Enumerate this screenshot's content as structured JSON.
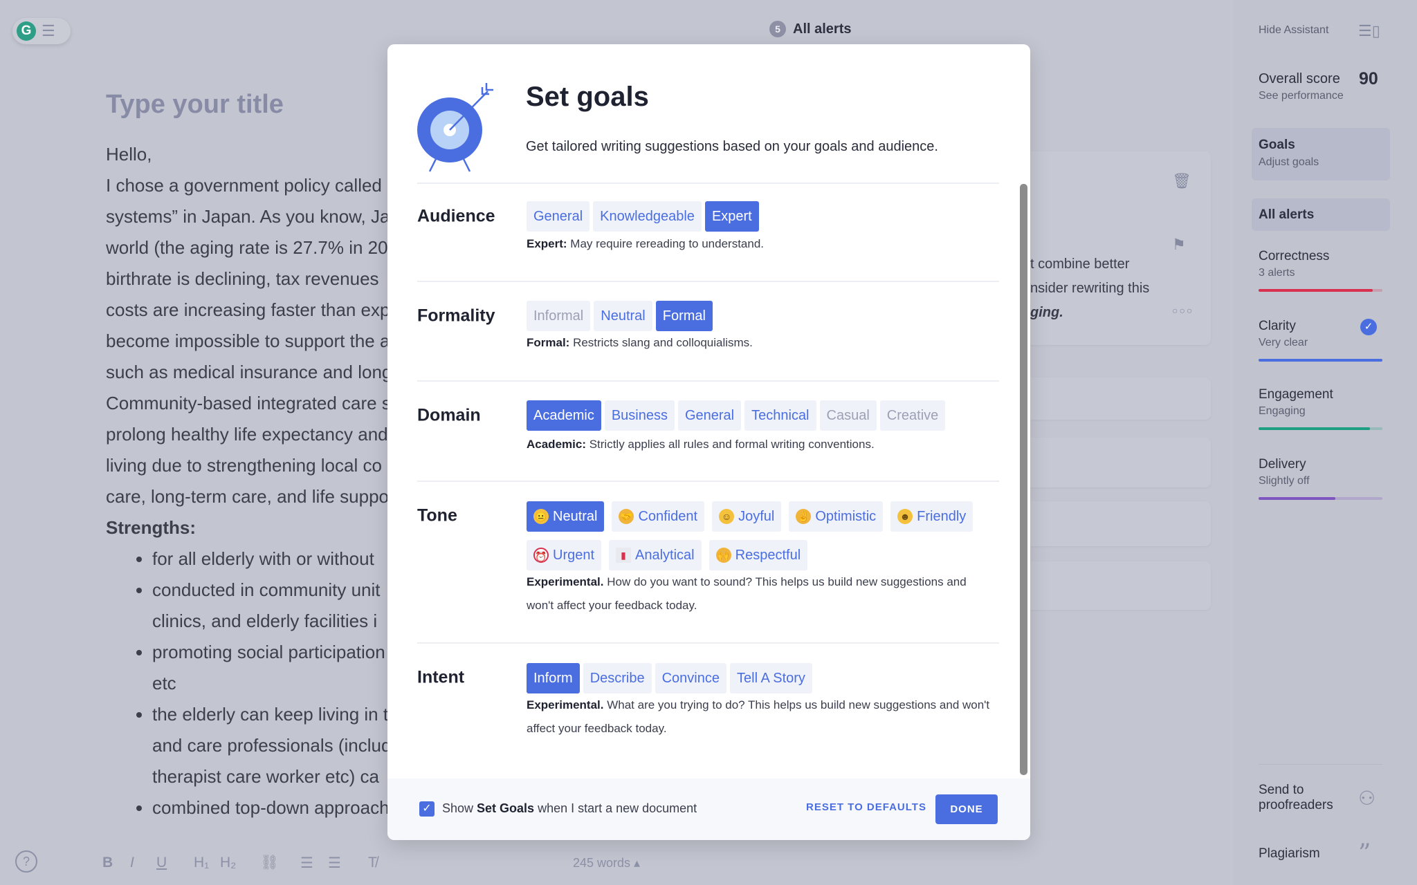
{
  "editor": {
    "title_placeholder": "Type your title",
    "lines": [
      "Hello,",
      "I chose a government policy called “",
      "systems” in Japan. As you know, Ja",
      "world (the aging rate is 27.7% in 20",
      "birthrate is declining, tax revenues",
      "costs are increasing faster than exp",
      "become impossible to support the a",
      "such as medical insurance and long",
      "Community-based integrated care s",
      "prolong healthy life expectancy and",
      "living due to strengthening local co",
      "care, long-term care, and life suppo"
    ],
    "strengths": "Strengths:",
    "bullets": [
      "for all elderly with or without",
      "conducted in community unit",
      "clinics, and elderly facilities i",
      "promoting social participation",
      "etc",
      "the elderly can keep living in t",
      "and care professionals (includ",
      "therapist care worker etc) ca",
      "combined top-down approach"
    ],
    "word_count": "245 words ▴"
  },
  "top": {
    "alert_count": "5",
    "alerts_label": "All alerts"
  },
  "card": {
    "line1": "t combine better",
    "line2": "nsider rewriting this",
    "line3": "ging."
  },
  "sidebar": {
    "hide": "Hide Assistant",
    "overall_label": "Overall score",
    "overall_score": "90",
    "see_performance": "See performance",
    "goals": "Goals",
    "adjust_goals": "Adjust goals",
    "all_alerts": "All alerts",
    "metrics": [
      {
        "name": "Correctness",
        "status": "3 alerts",
        "fill": 0.92,
        "color": "#d9304f"
      },
      {
        "name": "Clarity",
        "status": "Very clear",
        "fill": 1.0,
        "color": "#4a6ee0"
      },
      {
        "name": "Engagement",
        "status": "Engaging",
        "fill": 0.9,
        "color": "#1e9e82"
      },
      {
        "name": "Delivery",
        "status": "Slightly off",
        "fill": 0.62,
        "color": "#7f55c2"
      }
    ],
    "send": "Send to proofreaders",
    "plagiarism": "Plagiarism"
  },
  "modal": {
    "title": "Set goals",
    "subtitle": "Get tailored writing suggestions based on your goals and audience.",
    "audience": {
      "label": "Audience",
      "options": [
        "General",
        "Knowledgeable",
        "Expert"
      ],
      "selected": "Expert",
      "desc_bold": "Expert:",
      "desc": " May require rereading to understand."
    },
    "formality": {
      "label": "Formality",
      "options": [
        "Informal",
        "Neutral",
        "Formal"
      ],
      "selected": "Formal",
      "desc_bold": "Formal:",
      "desc": " Restricts slang and colloquialisms."
    },
    "domain": {
      "label": "Domain",
      "options": [
        "Academic",
        "Business",
        "General",
        "Technical",
        "Casual",
        "Creative"
      ],
      "selected": "Academic",
      "desc_bold": "Academic:",
      "desc": " Strictly applies all rules and formal writing conventions."
    },
    "tone": {
      "label": "Tone",
      "options": [
        "Neutral",
        "Confident",
        "Joyful",
        "Optimistic",
        "Friendly",
        "Urgent",
        "Analytical",
        "Respectful"
      ],
      "selected": "Neutral",
      "desc_bold": "Experimental.",
      "desc": " How do you want to sound? This helps us build new suggestions and won't affect your feedback today."
    },
    "intent": {
      "label": "Intent",
      "options": [
        "Inform",
        "Describe",
        "Convince",
        "Tell A Story"
      ],
      "selected": "Inform",
      "desc_bold": "Experimental.",
      "desc": " What are you trying to do? This helps us build new suggestions and won't affect your feedback today."
    },
    "footer": {
      "show_pre": "Show ",
      "show_bold": "Set Goals",
      "show_post": " when I start a new document",
      "checked": true,
      "reset": "RESET TO DEFAULTS",
      "done": "DONE"
    }
  },
  "colors": {
    "accent": "#4a6ee0"
  }
}
